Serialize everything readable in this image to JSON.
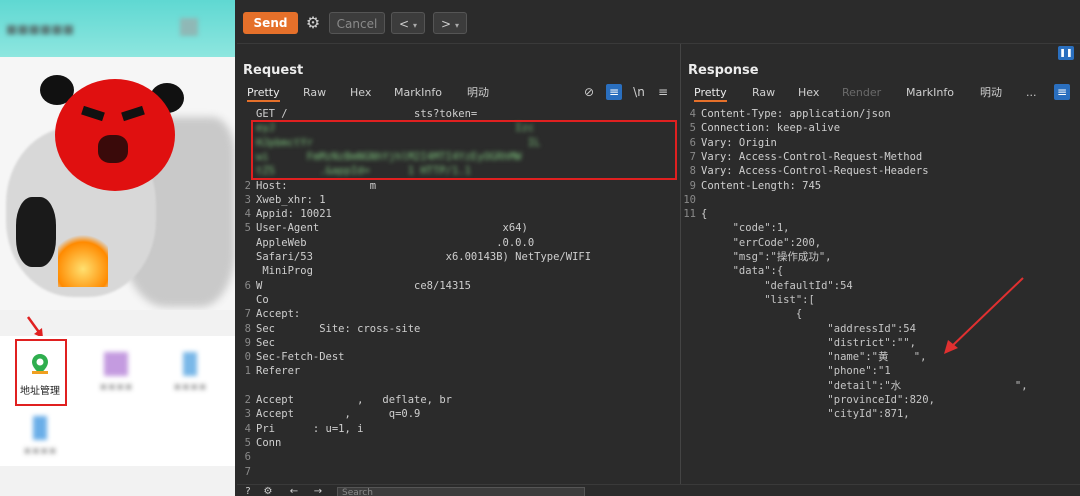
{
  "phone": {
    "grid": [
      {
        "label": "地址管理"
      },
      {
        "label": "××××"
      },
      {
        "label": "××××"
      },
      {
        "label": "××××"
      }
    ]
  },
  "toolbar": {
    "send_label": "Send",
    "cancel_label": "Cancel",
    "back_label": "<",
    "forward_label": ">",
    "dropdown_label": "▾"
  },
  "request": {
    "title": "Request",
    "tabs": [
      "Pretty",
      "Raw",
      "Hex",
      "MarkInfo",
      "明动"
    ],
    "wrap_label": "\\n",
    "lines": [
      {
        "n": "",
        "t": "GET /                    sts?token="
      },
      {
        "n": "",
        "t": "eyJ                                      Izc"
      },
      {
        "n": "",
        "t": "HJpbmctYr                                  IL"
      },
      {
        "n": "",
        "t": "wi      FmMzNzBmNGNhYjhlM2I4MTI4YzEyOGRhMW     "
      },
      {
        "n": "",
        "t": "tZS       .&appId=      1 HTTP/1.1"
      },
      {
        "n": "2",
        "t": "Host:             m"
      },
      {
        "n": "3",
        "t": "Xweb_xhr: 1"
      },
      {
        "n": "4",
        "t": "Appid: 10021"
      },
      {
        "n": "5",
        "t": "User-Agent                             x64)"
      },
      {
        "n": "",
        "t": "AppleWeb                              .0.0.0"
      },
      {
        "n": "",
        "t": "Safari/53                     x6.00143B) NetType/WIFI"
      },
      {
        "n": "",
        "t": " MiniProg"
      },
      {
        "n": "6",
        "t": "W                        ce8/14315"
      },
      {
        "n": "",
        "t": "Co"
      },
      {
        "n": "7",
        "t": "Accept:"
      },
      {
        "n": "8",
        "t": "Sec       Site: cross-site"
      },
      {
        "n": "9",
        "t": "Sec"
      },
      {
        "n": "0",
        "t": "Sec-Fetch-Dest"
      },
      {
        "n": "1",
        "t": "Referer"
      },
      {
        "n": "",
        "t": " "
      },
      {
        "n": "2",
        "t": "Accept          ,   deflate, br"
      },
      {
        "n": "3",
        "t": "Accept        ,      q=0.9"
      },
      {
        "n": "4",
        "t": "Pri      : u=1, i"
      },
      {
        "n": "5",
        "t": "Conn"
      },
      {
        "n": "6",
        "t": ""
      },
      {
        "n": "7",
        "t": ""
      }
    ]
  },
  "response": {
    "title": "Response",
    "tabs": [
      "Pretty",
      "Raw",
      "Hex",
      "Render",
      "MarkInfo",
      "明动",
      "..."
    ],
    "lines": [
      {
        "n": "4",
        "t": "Content-Type: application/json"
      },
      {
        "n": "5",
        "t": "Connection: keep-alive"
      },
      {
        "n": "6",
        "t": "Vary: Origin"
      },
      {
        "n": "7",
        "t": "Vary: Access-Control-Request-Method"
      },
      {
        "n": "8",
        "t": "Vary: Access-Control-Request-Headers"
      },
      {
        "n": "9",
        "t": "Content-Length: 745"
      },
      {
        "n": "10",
        "t": ""
      },
      {
        "n": "11",
        "t": "{"
      },
      {
        "n": "",
        "t": "     \"code\":1,"
      },
      {
        "n": "",
        "t": "     \"errCode\":200,"
      },
      {
        "n": "",
        "t": "     \"msg\":\"操作成功\","
      },
      {
        "n": "",
        "t": "     \"data\":{"
      },
      {
        "n": "",
        "t": "          \"defaultId\":54"
      },
      {
        "n": "",
        "t": "          \"list\":["
      },
      {
        "n": "",
        "t": "               {"
      },
      {
        "n": "",
        "t": "                    \"addressId\":54"
      },
      {
        "n": "",
        "t": "                    \"district\":\"\","
      },
      {
        "n": "",
        "t": "                    \"name\":\"黄    \","
      },
      {
        "n": "",
        "t": "                    \"phone\":\"1"
      },
      {
        "n": "",
        "t": "                    \"detail\":\"水                  \","
      },
      {
        "n": "",
        "t": "                    \"provinceId\":820,"
      },
      {
        "n": "",
        "t": "                    \"cityId\":871,"
      }
    ]
  },
  "bottombar": {
    "search_placeholder": "Search"
  }
}
